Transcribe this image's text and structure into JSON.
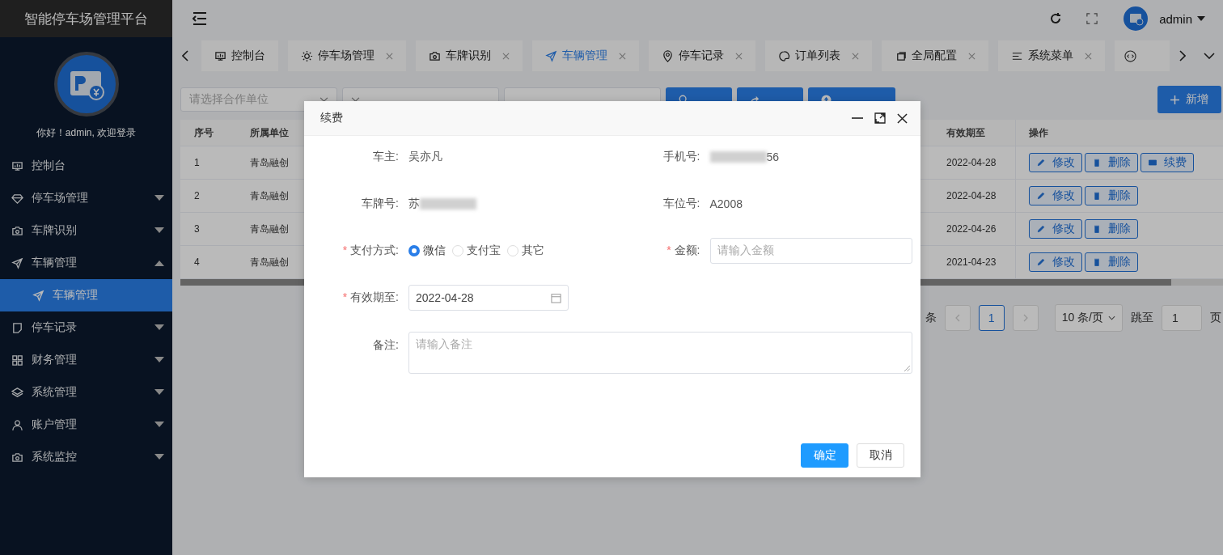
{
  "app_title": "智能停车场管理平台",
  "greeting": "你好！admin, 欢迎登录",
  "sidebar": {
    "items": [
      {
        "label": "控制台",
        "kind": "link",
        "selected": false
      },
      {
        "label": "停车场管理",
        "kind": "group",
        "expanded": false,
        "selected": false
      },
      {
        "label": "车牌识别",
        "kind": "group",
        "expanded": false,
        "selected": false
      },
      {
        "label": "车辆管理",
        "kind": "group",
        "expanded": true,
        "selected": false,
        "children": [
          {
            "label": "车辆管理",
            "selected": true
          }
        ]
      },
      {
        "label": "停车记录",
        "kind": "group",
        "expanded": false,
        "selected": false
      },
      {
        "label": "财务管理",
        "kind": "group",
        "expanded": false,
        "selected": false
      },
      {
        "label": "系统管理",
        "kind": "group",
        "expanded": false,
        "selected": false
      },
      {
        "label": "账户管理",
        "kind": "group",
        "expanded": false,
        "selected": false
      },
      {
        "label": "系统监控",
        "kind": "group",
        "expanded": false,
        "selected": false
      }
    ]
  },
  "header": {
    "user_name": "admin"
  },
  "tabs": [
    {
      "label": "控制台",
      "closable": false,
      "selected": false
    },
    {
      "label": "停车场管理",
      "closable": true,
      "selected": false
    },
    {
      "label": "车牌识别",
      "closable": true,
      "selected": false
    },
    {
      "label": "车辆管理",
      "closable": true,
      "selected": true
    },
    {
      "label": "停车记录",
      "closable": true,
      "selected": false
    },
    {
      "label": "订单列表",
      "closable": true,
      "selected": false
    },
    {
      "label": "全局配置",
      "closable": true,
      "selected": false
    },
    {
      "label": "系统菜单",
      "closable": true,
      "selected": false
    }
  ],
  "toolbar": {
    "fields": [
      {
        "kind": "select",
        "placeholder": "请选择合作单位"
      },
      {
        "kind": "select"
      },
      {
        "kind": "input"
      }
    ],
    "buttons": [
      {
        "kind": "search"
      },
      {
        "kind": "reset"
      },
      {
        "kind": "export"
      }
    ],
    "add_button": "新增"
  },
  "table": {
    "columns": [
      "序号",
      "所属单位",
      "有效期至",
      "操作"
    ],
    "rows": [
      {
        "index": "1",
        "unit": "青岛融创",
        "expiry": "2022-04-28",
        "actions": [
          "修改",
          "删除",
          "续费"
        ]
      },
      {
        "index": "2",
        "unit": "青岛融创",
        "expiry": "2022-04-28",
        "actions": [
          "修改",
          "删除"
        ]
      },
      {
        "index": "3",
        "unit": "青岛融创",
        "expiry": "2022-04-26",
        "actions": [
          "修改",
          "删除"
        ]
      },
      {
        "index": "4",
        "unit": "青岛融创",
        "expiry": "2021-04-23",
        "actions": [
          "修改",
          "删除"
        ]
      }
    ]
  },
  "pagination": {
    "total_suffix": "条",
    "prev_disabled": true,
    "page": "1",
    "next_disabled": true,
    "page_size": "10 条/页",
    "jump_label": "跳至",
    "jump_value": "1",
    "page_suffix": "页"
  },
  "dialog": {
    "title": "续费",
    "fields": [
      {
        "kind": "text",
        "label": "车主:",
        "value": "吴亦凡"
      },
      {
        "kind": "text",
        "label": "手机号:",
        "value": "56",
        "masked_prefix": true
      },
      {
        "kind": "text",
        "label": "车牌号:",
        "value": "苏",
        "masked_suffix": true
      },
      {
        "kind": "text",
        "label": "车位号:",
        "value": "A2008"
      },
      {
        "kind": "radio",
        "label": "支付方式:",
        "required_mark": "*",
        "options": [
          {
            "label": "微信",
            "selected": true
          },
          {
            "label": "支付宝",
            "selected": false
          },
          {
            "label": "其它",
            "selected": false
          }
        ]
      },
      {
        "kind": "input",
        "label": "金额:",
        "required_mark": "*",
        "placeholder": "请输入金额"
      },
      {
        "kind": "date",
        "label": "有效期至:",
        "required_mark": "*",
        "value": "2022-04-28"
      },
      {
        "kind": "textarea",
        "label": "备注:",
        "placeholder": "请输入备注"
      }
    ],
    "buttons": [
      {
        "label": "确定",
        "primary": true
      },
      {
        "label": "取消",
        "primary": false
      }
    ]
  }
}
